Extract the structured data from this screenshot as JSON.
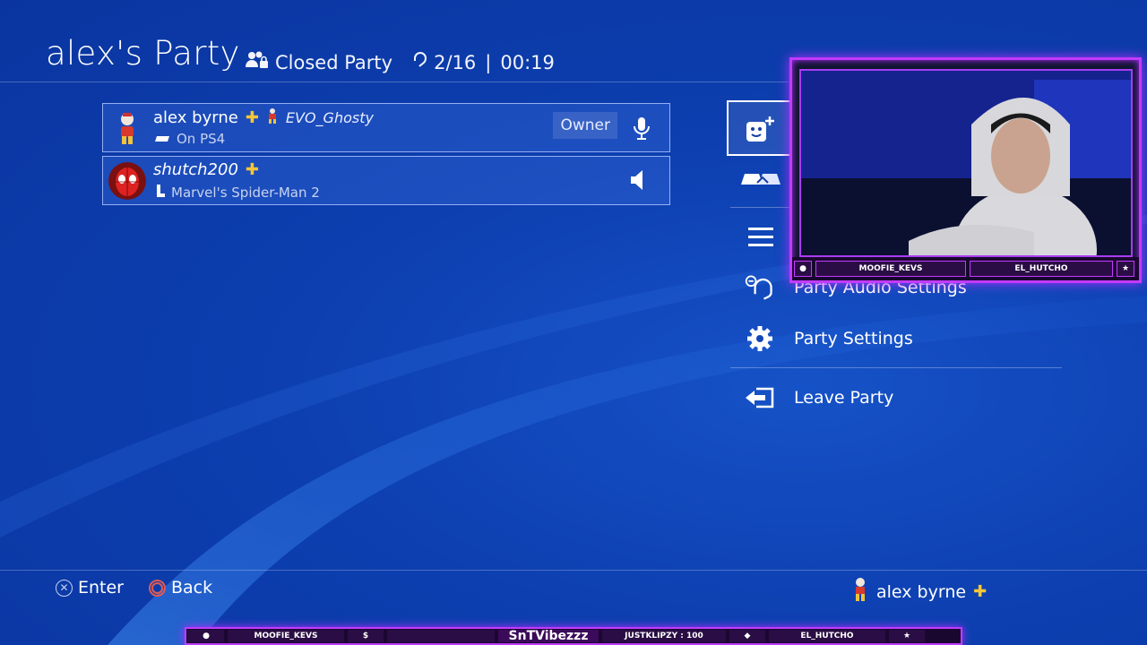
{
  "header": {
    "title": "alex's Party",
    "party_type": "Closed Party",
    "member_count": "2/16",
    "elapsed": "00:19"
  },
  "members": [
    {
      "name": "alex byrne",
      "secondary": "EVO_Ghosty",
      "status": "On PS4",
      "role": "Owner",
      "voice": "mic-icon"
    },
    {
      "name": "shutch200",
      "status": "Marvel's Spider-Man 2",
      "voice": "speaker-icon"
    }
  ],
  "menu": {
    "audio": "Party Audio Settings",
    "settings": "Party Settings",
    "leave": "Leave Party"
  },
  "footer": {
    "enter": "Enter",
    "back": "Back",
    "user": "alex byrne"
  },
  "overlay": {
    "cam_left": "MOOFIE_KEVS",
    "cam_right": "EL_HUTCHO",
    "bar": {
      "left": "MOOFIE_KEVS",
      "dollar": "$",
      "center": "SnTVibezzz",
      "tip": "JUSTKLIPZY : 100",
      "right": "EL_HUTCHO"
    }
  },
  "colors": {
    "background": "#0d3fb0",
    "plus": "#f6c636",
    "overlay": "#c23bff",
    "circle_button": "#e05a55"
  }
}
